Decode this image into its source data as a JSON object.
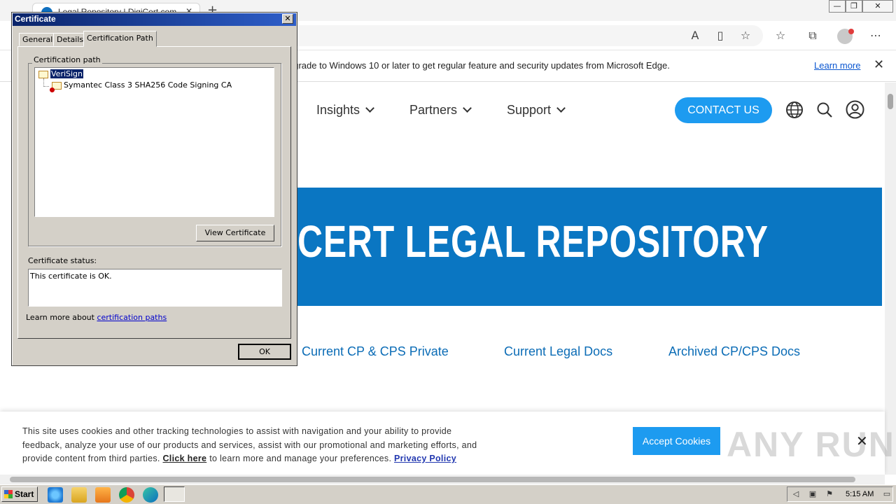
{
  "browser": {
    "tab_title": "Legal Repository | DigiCert.com",
    "tab_close": "✕",
    "new_tab": "+",
    "window_controls": {
      "minimize": "—",
      "restore": "❐",
      "close": "✕"
    },
    "toolbar_icons": [
      "read-aloud-icon",
      "immersive-reader-icon",
      "add-favorite-icon",
      "favorites-icon",
      "collections-icon",
      "profile-icon",
      "more-icon"
    ]
  },
  "infobar": {
    "text": "pgrade to Windows 10 or later to get regular feature and security updates from Microsoft Edge.",
    "learn_more": "Learn more",
    "close": "✕"
  },
  "site": {
    "nav": [
      {
        "label": "Insights"
      },
      {
        "label": "Partners"
      },
      {
        "label": "Support"
      }
    ],
    "contact_label": "CONTACT US",
    "hero_title": "CERT LEGAL REPOSITORY",
    "doc_links": [
      {
        "label": "Current CP & CPS Private"
      },
      {
        "label": "Current Legal Docs"
      },
      {
        "label": "Archived CP/CPS Docs"
      }
    ]
  },
  "cookie_banner": {
    "text_1": "This site uses cookies and other tracking technologies to assist with navigation and your ability to provide feedback, analyze your use of our products and services, assist with our promotional and marketing efforts, and provide content from third parties.",
    "click_here": "Click here",
    "text_2": "to learn more and manage your preferences.",
    "privacy_policy": "Privacy Policy",
    "accept_label": "Accept Cookies",
    "close": "✕",
    "watermark": "ANY RUN"
  },
  "certificate_dialog": {
    "title": "Certificate",
    "close": "✕",
    "tabs": [
      "General",
      "Details",
      "Certification Path"
    ],
    "active_tab": "Certification Path",
    "path_group_label": "Certification path",
    "path": [
      {
        "label": "VeriSign",
        "selected": true
      },
      {
        "label": "Symantec Class 3 SHA256 Code Signing CA",
        "selected": false
      }
    ],
    "view_certificate_label": "View Certificate",
    "status_label": "Certificate status:",
    "status_text": "This certificate is OK.",
    "learn_prefix": "Learn more about",
    "learn_link": "certification paths",
    "ok_label": "OK"
  },
  "taskbar": {
    "start_label": "Start",
    "apps": [
      "ie-icon",
      "explorer-icon",
      "media-player-icon",
      "chrome-icon",
      "edge-icon",
      "certificate-window-icon"
    ],
    "clock": "5:15 AM"
  },
  "colors": {
    "hero_blue": "#0a76c2",
    "contact_blue": "#1d9bf0",
    "link_blue": "#0b6cb6",
    "dialog_gray": "#d4d0c8",
    "title_bar": "#0a246a"
  }
}
